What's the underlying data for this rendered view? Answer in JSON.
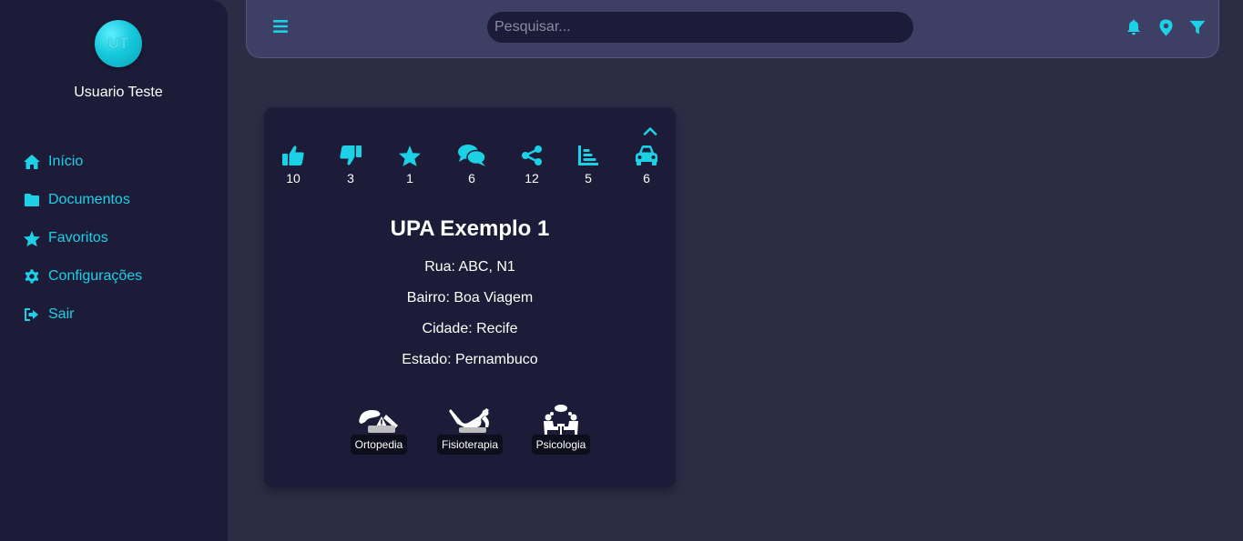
{
  "user": {
    "initials": "UT",
    "name": "Usuario Teste"
  },
  "sidebar": {
    "items": [
      {
        "label": "Início",
        "icon": "home-icon"
      },
      {
        "label": "Documentos",
        "icon": "folder-icon"
      },
      {
        "label": "Favoritos",
        "icon": "star-icon"
      },
      {
        "label": "Configurações",
        "icon": "gear-icon"
      },
      {
        "label": "Sair",
        "icon": "logout-icon"
      }
    ]
  },
  "topbar": {
    "search_placeholder": "Pesquisar...",
    "icons": [
      "menu-icon",
      "bell-icon",
      "location-pin-icon",
      "filter-icon"
    ]
  },
  "card": {
    "stats": [
      {
        "icon": "thumbs-up-icon",
        "count": "10"
      },
      {
        "icon": "thumbs-down-icon",
        "count": "3"
      },
      {
        "icon": "star-icon",
        "count": "1"
      },
      {
        "icon": "comments-icon",
        "count": "6"
      },
      {
        "icon": "share-icon",
        "count": "12"
      },
      {
        "icon": "bar-chart-icon",
        "count": "5"
      },
      {
        "icon": "car-icon",
        "count": "6"
      }
    ],
    "title": "UPA Exemplo 1",
    "rua": "Rua: ABC, N1",
    "bairro": "Bairro: Boa Viagem",
    "cidade": "Cidade: Recife",
    "estado": "Estado: Pernambuco",
    "specialties": [
      {
        "label": "Ortopedia",
        "icon": "orthopedics-icon"
      },
      {
        "label": "Fisioterapia",
        "icon": "physiotherapy-icon"
      },
      {
        "label": "Psicologia",
        "icon": "psychology-icon"
      }
    ]
  },
  "colors": {
    "accent": "#1cd0e6",
    "sidebar_bg": "#1c1c38",
    "page_bg": "#2c2d45",
    "topbar_bg": "#3e3f64"
  }
}
